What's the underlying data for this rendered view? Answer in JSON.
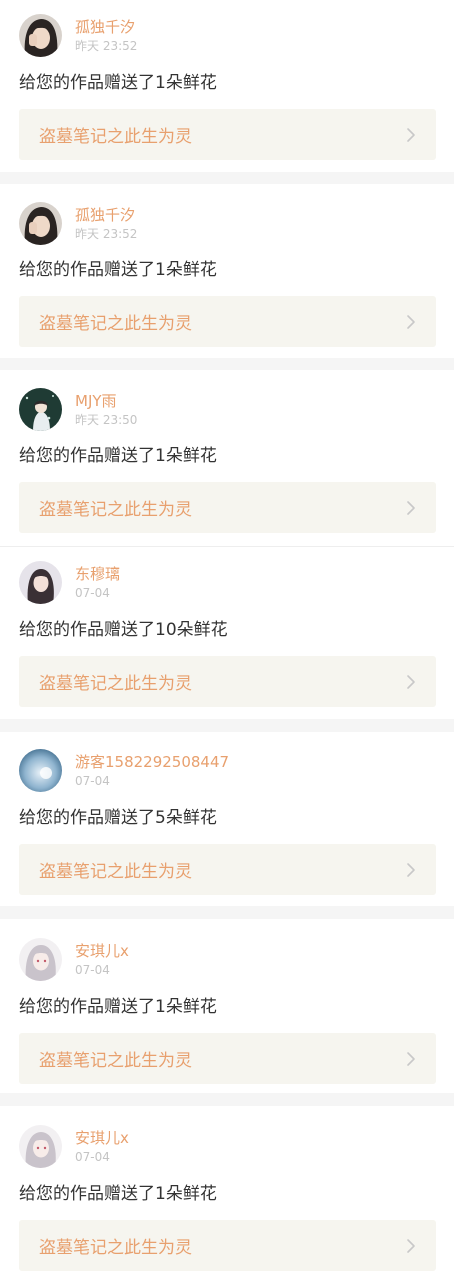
{
  "notifications": [
    {
      "username": "孤独千汐",
      "time": "昨天 23:52",
      "message": "给您的作品赠送了1朵鲜花",
      "work_title": "盗墓笔记之此生为灵",
      "avatar": "avatar-girl-dark-hair"
    },
    {
      "username": "孤独千汐",
      "time": "昨天 23:52",
      "message": "给您的作品赠送了1朵鲜花",
      "work_title": "盗墓笔记之此生为灵",
      "avatar": "avatar-girl-dark-hair"
    },
    {
      "username": "MJY雨",
      "time": "昨天 23:50",
      "message": "给您的作品赠送了1朵鲜花",
      "work_title": "盗墓笔记之此生为灵",
      "avatar": "avatar-anime-dark-green"
    },
    {
      "username": "东穆璃",
      "time": "07-04",
      "message": "给您的作品赠送了10朵鲜花",
      "work_title": "盗墓笔记之此生为灵",
      "avatar": "avatar-girl-long-hair"
    },
    {
      "username": "游客1582292508447",
      "time": "07-04",
      "message": "给您的作品赠送了5朵鲜花",
      "work_title": "盗墓笔记之此生为灵",
      "avatar": "avatar-blue-blur"
    },
    {
      "username": "安琪儿x",
      "time": "07-04",
      "message": "给您的作品赠送了1朵鲜花",
      "work_title": "盗墓笔记之此生为灵",
      "avatar": "avatar-anime-silver-hair"
    },
    {
      "username": "安琪儿x",
      "time": "07-04",
      "message": "给您的作品赠送了1朵鲜花",
      "work_title": "盗墓笔记之此生为灵",
      "avatar": "avatar-anime-silver-hair"
    }
  ],
  "colors": {
    "username": "#e8a06e",
    "time": "#c4c4c4",
    "message": "#333333",
    "link_bg": "#f6f5ef",
    "separator": "#f5f5f5"
  },
  "icons": {
    "link_arrow": "chevron-right-icon"
  }
}
